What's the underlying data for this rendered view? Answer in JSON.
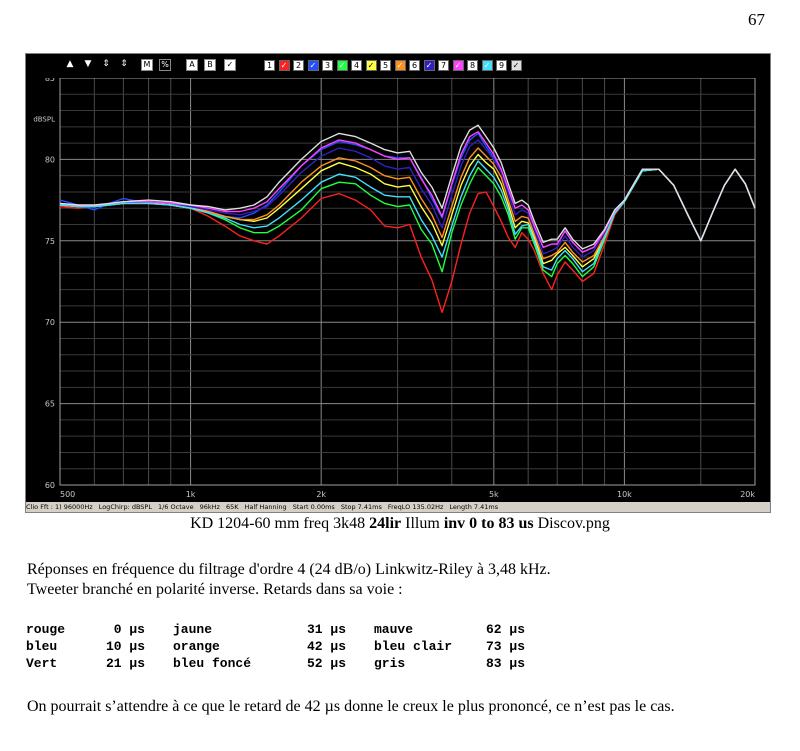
{
  "page_number": "67",
  "toolbar": {
    "nav": [
      "▲",
      "▼",
      "⇕",
      "⇕"
    ],
    "tools": [
      "M",
      "%",
      "A",
      "B",
      "✓"
    ],
    "chips": [
      {
        "label": "1",
        "color": "#ffffff"
      },
      {
        "label": "✓",
        "color": "#ff2020"
      },
      {
        "label": "2",
        "color": "#ffffff"
      },
      {
        "label": "✓",
        "color": "#2050ff"
      },
      {
        "label": "3",
        "color": "#ffffff"
      },
      {
        "label": "✓",
        "color": "#20ff40"
      },
      {
        "label": "4",
        "color": "#ffffff"
      },
      {
        "label": "✓",
        "color": "#ffff40"
      },
      {
        "label": "5",
        "color": "#ffffff"
      },
      {
        "label": "✓",
        "color": "#ff9020"
      },
      {
        "label": "6",
        "color": "#ffffff"
      },
      {
        "label": "✓",
        "color": "#3020c0"
      },
      {
        "label": "7",
        "color": "#ffffff"
      },
      {
        "label": "✓",
        "color": "#ff40ff"
      },
      {
        "label": "8",
        "color": "#ffffff"
      },
      {
        "label": "✓",
        "color": "#40e0ff"
      },
      {
        "label": "9",
        "color": "#ffffff"
      },
      {
        "label": "✓",
        "color": "#e0e0e0"
      }
    ]
  },
  "statusbar": [
    "Clio Fft : 1) 96000Hz",
    "LogChirp: dBSPL",
    "1/6 Octave",
    "96kHz",
    "65K",
    "Half Hanning",
    "Start 0.00ms",
    "Stop 7.41ms",
    "FreqLO 135.02Hz",
    "Length 7.41ms"
  ],
  "chart_data": {
    "type": "line",
    "y_unit_label": "dBSPL",
    "ylim": [
      60,
      85
    ],
    "yticks": [
      60,
      65,
      70,
      75,
      80,
      85
    ],
    "ytick_labels": [
      "60",
      "65",
      "70",
      "75",
      "80",
      "85"
    ],
    "xscale": "log",
    "xlim": [
      500,
      20000
    ],
    "xticks": [
      500,
      1000,
      2000,
      5000,
      10000,
      20000
    ],
    "xtick_labels": [
      "500",
      "1k",
      "2k",
      "5k",
      "10k",
      "20k"
    ],
    "grid": true,
    "x": [
      500,
      550,
      600,
      650,
      700,
      800,
      900,
      1000,
      1100,
      1200,
      1300,
      1400,
      1500,
      1600,
      1800,
      2000,
      2200,
      2400,
      2600,
      2800,
      3000,
      3200,
      3400,
      3600,
      3800,
      4000,
      4200,
      4400,
      4600,
      4800,
      5000,
      5200,
      5400,
      5600,
      5800,
      6000,
      6200,
      6500,
      6800,
      7000,
      7300,
      7600,
      8000,
      8500,
      9000,
      9500,
      10000,
      11000,
      12000,
      13000,
      14000,
      15000,
      16000,
      17000,
      18000,
      19000,
      20000
    ],
    "series": [
      {
        "name": "rouge",
        "color": "#ff2020",
        "y": [
          77.1,
          77.0,
          77.1,
          77.2,
          77.3,
          77.3,
          77.2,
          77.0,
          76.5,
          75.9,
          75.3,
          75.0,
          74.8,
          75.3,
          76.4,
          77.6,
          77.9,
          77.5,
          76.9,
          75.9,
          75.8,
          76.0,
          74.0,
          72.6,
          70.6,
          72.5,
          74.8,
          76.7,
          77.9,
          78.0,
          77.1,
          76.2,
          75.2,
          74.6,
          75.5,
          75.1,
          74.4,
          73.0,
          72.0,
          72.9,
          73.7,
          73.2,
          72.5,
          73.0,
          74.8,
          76.6,
          77.4,
          79.3,
          79.4,
          78.4,
          76.6,
          75.0,
          76.8,
          78.4,
          79.4,
          78.5,
          77.0
        ]
      },
      {
        "name": "bleu",
        "color": "#2050ff",
        "y": [
          77.5,
          77.2,
          76.9,
          77.3,
          77.6,
          77.3,
          77.4,
          77.2,
          76.8,
          76.5,
          76.4,
          76.7,
          77.2,
          78.0,
          79.6,
          80.6,
          81.1,
          80.9,
          80.6,
          80.2,
          80.1,
          80.1,
          78.9,
          77.6,
          76.4,
          78.4,
          80.1,
          81.2,
          81.6,
          80.8,
          80.1,
          79.3,
          78.1,
          77.0,
          77.2,
          76.9,
          75.9,
          74.6,
          74.8,
          74.8,
          75.6,
          74.9,
          74.3,
          74.6,
          75.6,
          76.8,
          77.5,
          79.4,
          79.4,
          78.4,
          76.6,
          75.0,
          76.8,
          78.4,
          79.4,
          78.5,
          77.0
        ]
      },
      {
        "name": "Vert",
        "color": "#20ff40",
        "y": [
          77.2,
          77.1,
          77.1,
          77.2,
          77.3,
          77.3,
          77.2,
          77.0,
          76.7,
          76.3,
          75.8,
          75.5,
          75.5,
          75.9,
          76.9,
          78.2,
          78.6,
          78.5,
          77.8,
          77.3,
          77.1,
          77.2,
          75.7,
          74.8,
          73.1,
          75.5,
          77.2,
          78.5,
          79.5,
          79.0,
          78.5,
          77.7,
          76.6,
          75.1,
          75.8,
          75.8,
          74.8,
          73.2,
          72.8,
          73.6,
          74.1,
          73.6,
          72.8,
          73.4,
          75.1,
          76.7,
          77.4,
          79.3,
          79.4,
          78.4,
          76.6,
          75.0,
          76.8,
          78.4,
          79.4,
          78.5,
          77.0
        ]
      },
      {
        "name": "jaune",
        "color": "#ffff40",
        "y": [
          77.2,
          77.1,
          77.1,
          77.2,
          77.3,
          77.4,
          77.2,
          77.0,
          76.8,
          76.5,
          76.3,
          76.2,
          76.4,
          77.0,
          78.2,
          79.3,
          79.8,
          79.5,
          79.1,
          78.5,
          78.3,
          78.4,
          77.1,
          76.1,
          74.7,
          76.6,
          78.4,
          79.6,
          80.3,
          79.8,
          79.4,
          78.5,
          77.2,
          75.8,
          76.2,
          76.1,
          75.2,
          73.6,
          73.8,
          74.2,
          74.6,
          74.1,
          73.4,
          73.9,
          75.2,
          76.7,
          77.4,
          79.3,
          79.4,
          78.4,
          76.6,
          75.0,
          76.8,
          78.4,
          79.4,
          78.5,
          77.0
        ]
      },
      {
        "name": "orange",
        "color": "#ff9020",
        "y": [
          77.2,
          77.1,
          77.1,
          77.2,
          77.3,
          77.4,
          77.3,
          77.1,
          76.8,
          76.5,
          76.3,
          76.3,
          76.6,
          77.2,
          78.6,
          79.6,
          80.1,
          79.9,
          79.5,
          79.0,
          78.8,
          78.9,
          77.6,
          76.6,
          75.2,
          77.1,
          78.9,
          80.1,
          80.7,
          80.2,
          79.7,
          78.9,
          77.5,
          76.2,
          76.5,
          76.4,
          75.4,
          73.9,
          74.1,
          74.3,
          74.9,
          74.3,
          73.7,
          74.1,
          75.3,
          76.7,
          77.4,
          79.3,
          79.4,
          78.4,
          76.6,
          75.0,
          76.8,
          78.4,
          79.4,
          78.5,
          77.0
        ]
      },
      {
        "name": "bleu foncé",
        "color": "#3020c0",
        "y": [
          77.3,
          77.1,
          77.1,
          77.2,
          77.3,
          77.4,
          77.3,
          77.1,
          76.9,
          76.7,
          76.6,
          76.8,
          77.1,
          77.8,
          79.2,
          80.2,
          80.7,
          80.5,
          80.1,
          79.6,
          79.4,
          79.5,
          78.2,
          77.2,
          75.8,
          77.8,
          79.6,
          80.8,
          81.2,
          80.6,
          80.0,
          79.2,
          77.9,
          76.6,
          76.9,
          76.7,
          75.7,
          74.2,
          74.4,
          74.6,
          75.3,
          74.6,
          74.0,
          74.4,
          75.5,
          76.8,
          77.5,
          79.4,
          79.4,
          78.4,
          76.6,
          75.0,
          76.8,
          78.4,
          79.4,
          78.5,
          77.0
        ]
      },
      {
        "name": "mauve",
        "color": "#ff40ff",
        "y": [
          77.3,
          77.2,
          77.1,
          77.3,
          77.4,
          77.4,
          77.3,
          77.2,
          77.0,
          76.8,
          76.8,
          77.0,
          77.4,
          78.2,
          79.6,
          80.7,
          81.2,
          81.0,
          80.6,
          80.2,
          80.0,
          80.1,
          78.8,
          77.8,
          76.5,
          78.5,
          80.3,
          81.4,
          81.7,
          81.0,
          80.3,
          79.4,
          78.2,
          77.0,
          77.2,
          76.9,
          75.9,
          74.6,
          74.8,
          74.8,
          75.6,
          74.9,
          74.3,
          74.6,
          75.6,
          76.8,
          77.5,
          79.4,
          79.4,
          78.4,
          76.6,
          75.0,
          76.8,
          78.4,
          79.4,
          78.5,
          77.0
        ]
      },
      {
        "name": "bleu clair",
        "color": "#40e0ff",
        "y": [
          77.2,
          77.1,
          77.1,
          77.2,
          77.3,
          77.3,
          77.2,
          77.0,
          76.7,
          76.4,
          76.0,
          75.8,
          75.9,
          76.4,
          77.5,
          78.6,
          79.1,
          78.9,
          78.3,
          77.8,
          77.7,
          77.7,
          76.3,
          75.3,
          74.0,
          75.9,
          77.7,
          79.0,
          79.9,
          79.4,
          78.9,
          78.1,
          76.9,
          75.4,
          75.9,
          76.0,
          75.0,
          73.4,
          73.2,
          73.9,
          74.4,
          73.9,
          73.1,
          73.6,
          75.2,
          76.7,
          77.4,
          79.3,
          79.4,
          78.4,
          76.6,
          75.0,
          76.8,
          78.4,
          79.4,
          78.5,
          77.0
        ]
      },
      {
        "name": "gris",
        "color": "#e0e0e0",
        "y": [
          77.3,
          77.2,
          77.2,
          77.3,
          77.4,
          77.5,
          77.4,
          77.2,
          77.1,
          76.9,
          77.0,
          77.2,
          77.7,
          78.6,
          80.0,
          81.1,
          81.6,
          81.4,
          81.0,
          80.6,
          80.4,
          80.5,
          79.2,
          78.3,
          77.0,
          79.0,
          80.8,
          81.8,
          82.1,
          81.4,
          80.7,
          79.8,
          78.5,
          77.3,
          77.5,
          77.2,
          76.2,
          74.9,
          75.1,
          75.1,
          75.8,
          75.1,
          74.5,
          74.8,
          75.7,
          76.9,
          77.5,
          79.4,
          79.4,
          78.4,
          76.6,
          75.0,
          76.8,
          78.4,
          79.4,
          78.5,
          77.0
        ]
      }
    ]
  },
  "caption": {
    "part1": "KD 1204-60 mm freq 3k48 ",
    "bold1": "24lir",
    "part2": " Illum ",
    "bold2": "inv 0 to 83 us",
    "part3": " Discov.png"
  },
  "para1_line1": "Réponses en fréquence du filtrage d'ordre 4 (24 dB/o) Linkwitz-Riley à 3,48 kHz.",
  "para1_line2": "Tweeter branché en polarité inverse. Retards dans sa voie :",
  "delays": [
    [
      "rouge",
      "0 µs",
      "jaune",
      "31 µs",
      "mauve",
      "62 µs"
    ],
    [
      "bleu",
      "10 µs",
      "orange",
      "42 µs",
      "bleu clair",
      "73 µs"
    ],
    [
      "Vert",
      "21 µs",
      "bleu foncé",
      "52 µs",
      "gris",
      "83 µs"
    ]
  ],
  "para2": "On pourrait s’attendre à ce que le retard de 42 µs donne le creux le plus prononcé, ce n’est pas le cas."
}
